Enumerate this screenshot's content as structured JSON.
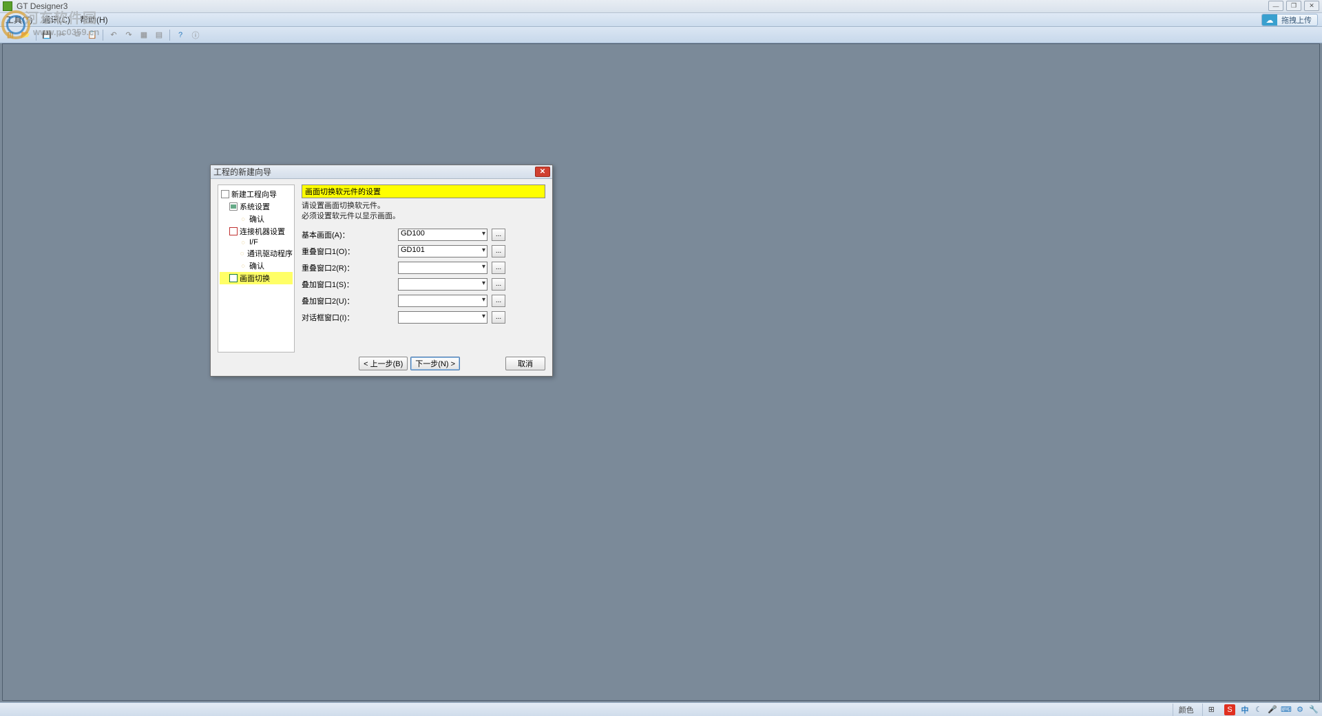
{
  "app": {
    "title": "GT Designer3"
  },
  "watermark": {
    "line1": "河东软件园",
    "line2": "www.pc0359.cn"
  },
  "menus": {
    "tools": "工具(T)",
    "comm": "通讯(C)",
    "help": "帮助(H)"
  },
  "upload_button": "拖拽上传",
  "wizard": {
    "title": "工程的新建向导",
    "section_title": "画面切换软元件的设置",
    "desc_line1": "请设置画面切换软元件。",
    "desc_line2": "必须设置软元件以显示画面。",
    "tree": {
      "root": "新建工程向导",
      "sys": "系统设置",
      "sys_confirm": "确认",
      "conn": "连接机器设置",
      "if": "I/F",
      "driver": "通讯驱动程序",
      "conn_confirm": "确认",
      "screen": "画面切换"
    },
    "fields": {
      "base": {
        "label": "基本画面(A)：",
        "value": "GD100"
      },
      "overlap1": {
        "label": "重叠窗口1(O)：",
        "value": "GD101"
      },
      "overlap2": {
        "label": "重叠窗口2(R)：",
        "value": ""
      },
      "super1": {
        "label": "叠加窗口1(S)：",
        "value": ""
      },
      "super2": {
        "label": "叠加窗口2(U)：",
        "value": ""
      },
      "dialog": {
        "label": "对话框窗口(I)：",
        "value": ""
      }
    },
    "buttons": {
      "back": "< 上一步(B)",
      "next": "下一步(N) >",
      "cancel": "取消"
    }
  },
  "statusbar": {
    "color": "颜色",
    "ime": "中"
  }
}
